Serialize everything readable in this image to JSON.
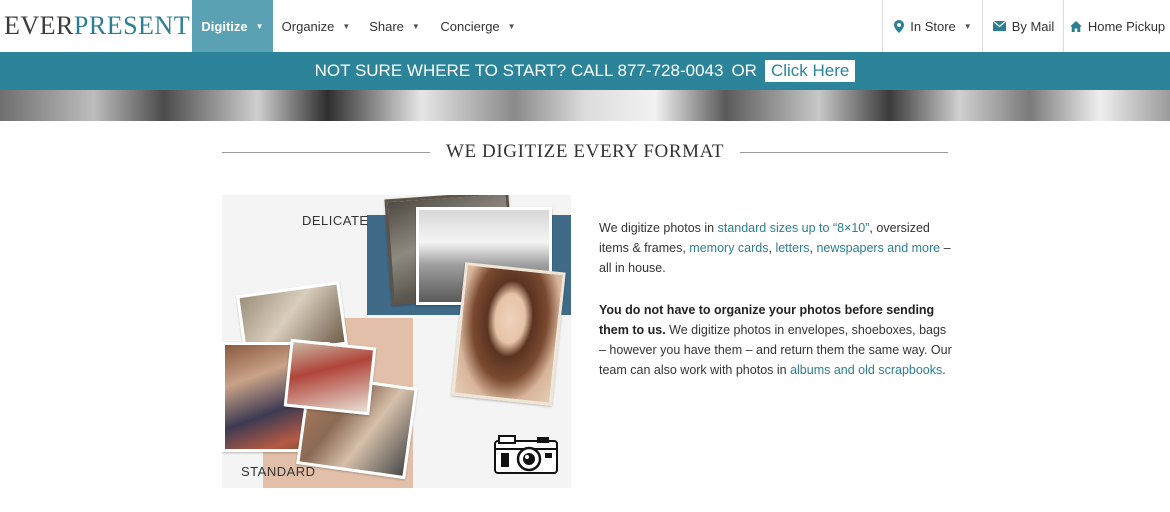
{
  "brand": {
    "logo_part1": "EVER",
    "logo_part2": "PRESENT"
  },
  "nav": {
    "items": [
      {
        "label": "Digitize",
        "active": true
      },
      {
        "label": "Organize"
      },
      {
        "label": "Share"
      },
      {
        "label": "Concierge"
      }
    ],
    "right": [
      {
        "label": "In Store",
        "icon": "map-pin-icon",
        "has_caret": true
      },
      {
        "label": "By Mail",
        "icon": "envelope-icon"
      },
      {
        "label": "Home Pickup",
        "icon": "house-icon"
      }
    ]
  },
  "banner": {
    "text": "NOT SURE WHERE TO START? CALL 877-728-0043",
    "or": "OR",
    "cta": "Click Here"
  },
  "section": {
    "title": "WE DIGITIZE EVERY FORMAT"
  },
  "collage": {
    "label_top": "DELICATE",
    "label_bottom": "STANDARD"
  },
  "copy": {
    "p1": {
      "t1": "We digitize photos in ",
      "l1": "standard sizes up to “8×10”",
      "t2": ", oversized items & frames, ",
      "l2": "memory cards",
      "t3": ", ",
      "l3": "letters",
      "t4": ", ",
      "l4": "newspapers and more",
      "t5": " – all in house."
    },
    "p2": {
      "bold": "You do not have to organize your photos before sending them to us.",
      "t1": " We digitize photos in envelopes, shoeboxes, bags – however you have them – and return them the same way. Our team can also work with photos in ",
      "l1": "albums and old scrapbooks",
      "t2": "."
    }
  },
  "colors": {
    "teal": "#2b8499",
    "nav_active": "#5aa2b3",
    "link": "#2b7f93"
  }
}
